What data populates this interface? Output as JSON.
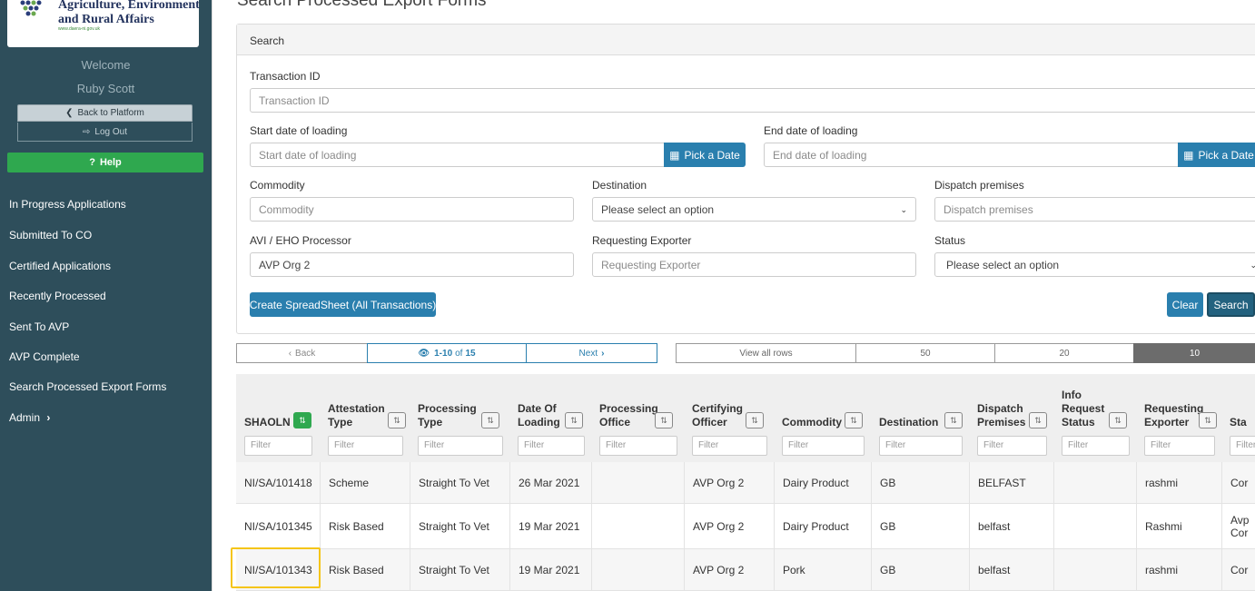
{
  "sidebar": {
    "logo_line1": "Agriculture, Environment",
    "logo_line2": "and Rural Affairs",
    "logo_url": "www.daera-ni.gov.uk",
    "welcome": "Welcome",
    "user_name": "Ruby Scott",
    "back_label": "Back to Platform",
    "logout_label": "Log Out",
    "help_label": "Help",
    "nav": [
      "In Progress Applications",
      "Submitted To CO",
      "Certified Applications",
      "Recently Processed",
      "Sent To AVP",
      "AVP Complete",
      "Search Processed Export Forms",
      "Admin"
    ]
  },
  "page": {
    "title": "Search Processed Export Forms"
  },
  "search": {
    "heading": "Search",
    "transaction_id": {
      "label": "Transaction ID",
      "placeholder": "Transaction ID"
    },
    "start_date": {
      "label": "Start date of loading",
      "placeholder": "Start date of loading"
    },
    "end_date": {
      "label": "End date of loading",
      "placeholder": "End date of loading"
    },
    "pick_date_label": "Pick a Date",
    "commodity": {
      "label": "Commodity",
      "placeholder": "Commodity"
    },
    "destination": {
      "label": "Destination",
      "value": "Please select an option"
    },
    "dispatch": {
      "label": "Dispatch premises",
      "placeholder": "Dispatch premises"
    },
    "processor": {
      "label": "AVI / EHO Processor",
      "value": "AVP Org 2"
    },
    "exporter": {
      "label": "Requesting Exporter",
      "placeholder": "Requesting Exporter"
    },
    "status": {
      "label": "Status",
      "value": "Please select an option"
    },
    "spreadsheet_label": "Create SpreadSheet (All Transactions)",
    "clear_label": "Clear",
    "search_label": "Search"
  },
  "pager": {
    "back_label": "Back",
    "range": "1-10",
    "of_label": "of",
    "total": "15",
    "next_label": "Next",
    "view_all": "View all rows",
    "sizes": [
      "50",
      "20",
      "10"
    ]
  },
  "table": {
    "filter_placeholder": "Filter",
    "columns": [
      "SHAOLN",
      "Attestation Type",
      "Processing Type",
      "Date Of Loading",
      "Processing Office",
      "Certifying Officer",
      "Commodity",
      "Destination",
      "Dispatch Premises",
      "Info Request Status",
      "Requesting Exporter",
      "Sta"
    ],
    "rows": [
      [
        "NI/SA/101418",
        "Scheme",
        "Straight To Vet",
        "26 Mar 2021",
        "",
        "AVP Org 2",
        "Dairy Product",
        "GB",
        "BELFAST",
        "",
        "rashmi",
        "Cor"
      ],
      [
        "NI/SA/101345",
        "Risk Based",
        "Straight To Vet",
        "19 Mar 2021",
        "",
        "AVP Org 2",
        "Dairy Product",
        "GB",
        "belfast",
        "",
        "Rashmi",
        "Avp Cor"
      ],
      [
        "NI/SA/101343",
        "Risk Based",
        "Straight To Vet",
        "19 Mar 2021",
        "",
        "AVP Org 2",
        "Pork",
        "GB",
        "belfast",
        "",
        "rashmi",
        "Cor"
      ]
    ]
  },
  "colors": {
    "sidebar": "#2e4e5b",
    "primary": "#2a7fae",
    "help": "#2fa84f",
    "highlight": "#f5c518"
  }
}
